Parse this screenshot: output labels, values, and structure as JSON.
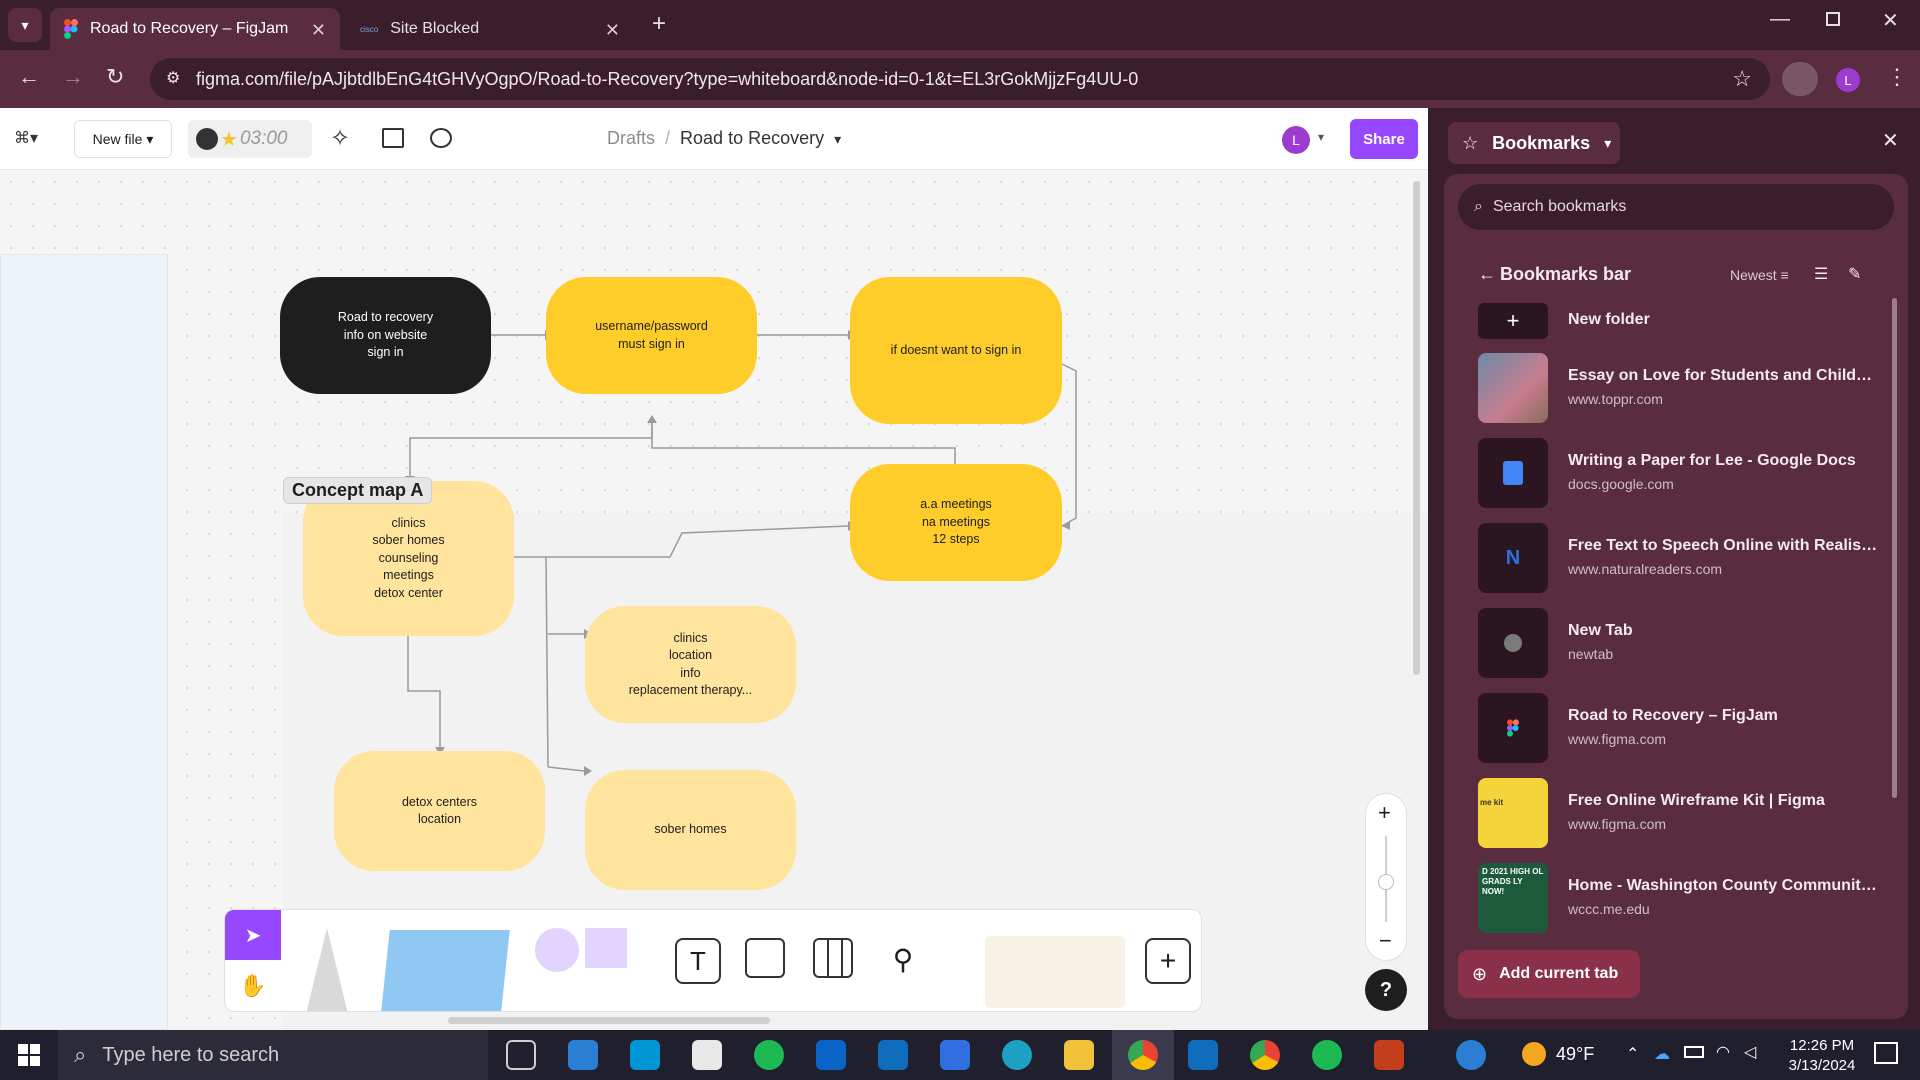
{
  "browser": {
    "tabs": [
      {
        "title": "Road to Recovery – FigJam",
        "active": true
      },
      {
        "title": "Site Blocked",
        "active": false
      }
    ],
    "url": "figma.com/file/pAJjbtdlbEnG4tGHVyOgpO/Road-to-Recovery?type=whiteboard&node-id=0-1&t=EL3rGokMjjzFg4UU-0",
    "profile_initial": "L"
  },
  "figjam": {
    "new_file_label": "New file",
    "timer": "03:00",
    "breadcrumb_parent": "Drafts",
    "breadcrumb_separator": "/",
    "file_name": "Road to Recovery",
    "avatar_initial": "L",
    "share_label": "Share",
    "section_label": "Concept map A",
    "nodes": {
      "n1": "Road to recovery\ninfo on website\nsign in",
      "n2": "username/password\nmust sign in",
      "n3": "if doesnt want to sign in",
      "n4": "a.a meetings\nna meetings\n12 steps",
      "n5": "clinics\nsober homes\ncounseling\nmeetings\ndetox center",
      "n6": "clinics\nlocation\ninfo\nreplacement therapy...",
      "n7": "detox centers\nlocation",
      "n8": "sober homes"
    },
    "zoom_in": "+",
    "zoom_out": "−",
    "help": "?"
  },
  "bookmarks": {
    "panel_title": "Bookmarks",
    "search_placeholder": "Search bookmarks",
    "folder_title": "Bookmarks bar",
    "sort_label": "Newest",
    "new_folder_label": "New folder",
    "items": [
      {
        "title": "Essay on Love for Students and Children | ...",
        "url": "www.toppr.com"
      },
      {
        "title": "Writing a Paper for Lee - Google Docs",
        "url": "docs.google.com"
      },
      {
        "title": "Free Text to Speech Online with Realistic AI...",
        "url": "www.naturalreaders.com"
      },
      {
        "title": "New Tab",
        "url": "newtab"
      },
      {
        "title": "Road to Recovery – FigJam",
        "url": "www.figma.com"
      },
      {
        "title": "Free Online Wireframe Kit | Figma",
        "url": "www.figma.com"
      },
      {
        "title": "Home - Washington County Community C...",
        "url": "wccc.me.edu"
      }
    ],
    "add_current_tab_label": "Add current tab",
    "thumb_text": {
      "wireframe": "me kit",
      "washington": "D 2021 HIGH OL GRADS LY NOW!"
    }
  },
  "taskbar": {
    "search_placeholder": "Type here to search",
    "weather": "49°F",
    "time": "12:26 PM",
    "date": "3/13/2024"
  },
  "colors": {
    "accent": "#9747ff",
    "chrome_dark": "#3b1e2b",
    "chrome_mid": "#5a2c3f",
    "node_yellow": "#ffcd29",
    "node_pale": "#ffe49e"
  }
}
